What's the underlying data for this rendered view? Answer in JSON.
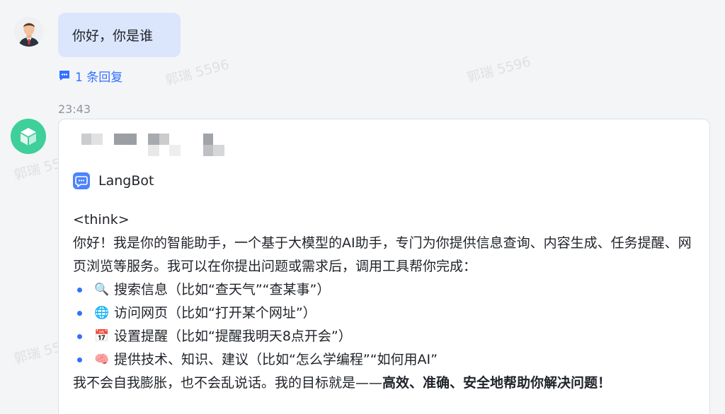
{
  "watermark": "郭瑞 5596",
  "user_message": {
    "avatar_icon": "user-avatar-icon",
    "text": "你好，你是谁",
    "reply_link": "1 条回复"
  },
  "bot_message": {
    "time": "23:43",
    "avatar_icon": "cube-icon",
    "app_name": "LangBot",
    "think_tag": "<think>",
    "intro": "你好！我是你的智能助手，一个基于大模型的AI助手，专门为你提供信息查询、内容生成、任务提醒、网页浏览等服务。我可以在你提出问题或需求后，调用工具帮你完成：",
    "bullets": [
      {
        "emoji": "🔍",
        "text": "搜索信息（比如“查天气”“查某事”）"
      },
      {
        "emoji": "🌐",
        "text": "访问网页（比如“打开某个网址”）"
      },
      {
        "emoji": "📅",
        "text": "设置提醒（比如“提醒我明天8点开会”）"
      },
      {
        "emoji": "🧠",
        "text": "提供技术、知识、建议（比如“怎么学编程”“如何用AI”"
      }
    ],
    "closing_normal": "我不会自我膨胀，也不会乱说话。我的目标就是——",
    "closing_bold": "高效、准确、安全地帮助你解决问题！"
  },
  "colors": {
    "accent": "#3370ff",
    "user_bubble": "#dbe6fd",
    "bot_avatar": "#3fcf9a"
  }
}
